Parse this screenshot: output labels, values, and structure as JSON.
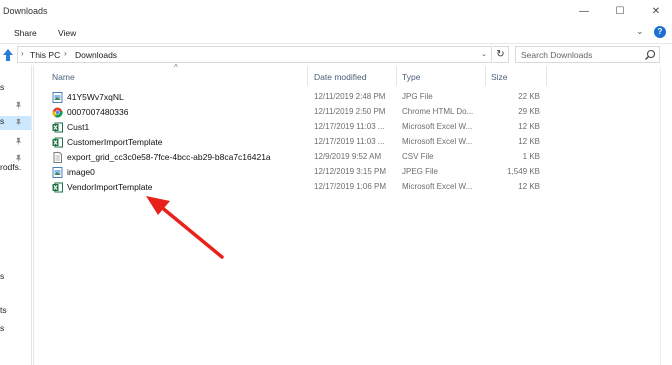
{
  "window": {
    "title": "Downloads",
    "min_glyph": "—",
    "max_glyph": "☐",
    "close_glyph": "✕"
  },
  "ribbon": {
    "tabs": [
      "Share",
      "View"
    ],
    "expand_glyph": "⌄",
    "help_glyph": "?"
  },
  "address": {
    "crumbs": [
      "This PC",
      "Downloads"
    ],
    "separator": "›",
    "dropdown_glyph": "⌄",
    "refresh_glyph": "↻"
  },
  "search": {
    "placeholder": "Search Downloads"
  },
  "nav": {
    "items": [
      "s",
      "s",
      "rodfs.",
      "s",
      "ts",
      "s"
    ]
  },
  "columns": {
    "name": "Name",
    "date": "Date modified",
    "type": "Type",
    "size": "Size",
    "sort_glyph": "^"
  },
  "files": [
    {
      "name": "41Y5Wv7xqNL",
      "date": "12/11/2019 2:48 PM",
      "type": "JPG File",
      "size": "22 KB",
      "icon": "image-file-icon"
    },
    {
      "name": "0007007480336",
      "date": "12/11/2019 2:50 PM",
      "type": "Chrome HTML Do...",
      "size": "29 KB",
      "icon": "chrome-html-icon"
    },
    {
      "name": "Cust1",
      "date": "12/17/2019 11:03 ...",
      "type": "Microsoft Excel W...",
      "size": "12 KB",
      "icon": "excel-file-icon"
    },
    {
      "name": "CustomerImportTemplate",
      "date": "12/17/2019 11:03 ...",
      "type": "Microsoft Excel W...",
      "size": "12 KB",
      "icon": "excel-file-icon"
    },
    {
      "name": "export_grid_cc3c0e58-7fce-4bcc-ab29-b8ca7c16421a",
      "date": "12/9/2019 9:52 AM",
      "type": "CSV File",
      "size": "1 KB",
      "icon": "csv-file-icon"
    },
    {
      "name": "image0",
      "date": "12/12/2019 3:15 PM",
      "type": "JPEG File",
      "size": "1,549 KB",
      "icon": "image-file-icon"
    },
    {
      "name": "VendorImportTemplate",
      "date": "12/17/2019 1:06 PM",
      "type": "Microsoft Excel W...",
      "size": "12 KB",
      "icon": "excel-file-icon"
    }
  ],
  "colors": {
    "annotation_arrow": "#e8211b",
    "selection": "#cce8ff",
    "header_text": "#4c607a"
  }
}
